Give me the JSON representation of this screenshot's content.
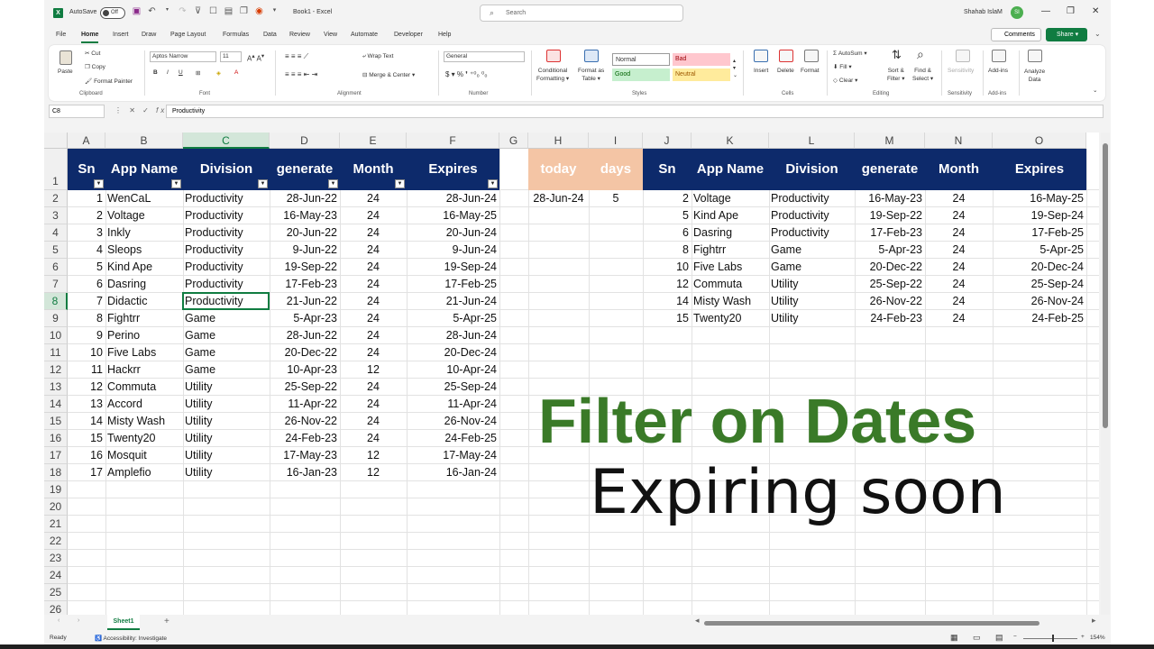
{
  "titlebar": {
    "autosave_label": "AutoSave",
    "autosave_state": "Off",
    "document_title": "Book1 - Excel",
    "search_placeholder": "Search",
    "user_name": "Shahab IslaM",
    "user_initials": "SI",
    "comments_label": "Comments",
    "share_label": "Share ▾"
  },
  "tabs": [
    "File",
    "Home",
    "Insert",
    "Draw",
    "Page Layout",
    "Formulas",
    "Data",
    "Review",
    "View",
    "Automate",
    "Developer",
    "Help"
  ],
  "ribbon": {
    "paste": "Paste",
    "cut": "Cut",
    "copy": "Copy",
    "format_painter": "Format Painter",
    "font_name": "Aptos Narrow",
    "font_size": "11",
    "wrap_text": "Wrap Text",
    "merge_center": "Merge & Center",
    "number_format": "General",
    "conditional_formatting_1": "Conditional",
    "conditional_formatting_2": "Formatting ▾",
    "format_as_table_1": "Format as",
    "format_as_table_2": "Table ▾",
    "styles": [
      "Normal",
      "Bad",
      "Good",
      "Neutral"
    ],
    "insert": "Insert",
    "delete": "Delete",
    "format": "Format",
    "autosum": "AutoSum",
    "fill": "Fill",
    "clear": "Clear",
    "sort_filter_1": "Sort &",
    "sort_filter_2": "Filter ▾",
    "find_select_1": "Find &",
    "find_select_2": "Select ▾",
    "sensitivity": "Sensitivity",
    "add_ins": "Add-ins",
    "analyze_data_1": "Analyze",
    "analyze_data_2": "Data",
    "groups": [
      "Clipboard",
      "Font",
      "Alignment",
      "Number",
      "Styles",
      "Cells",
      "Editing",
      "Sensitivity",
      "Add-ins"
    ]
  },
  "formula_bar": {
    "name_box": "C8",
    "content": "Productivity"
  },
  "columns": [
    "A",
    "B",
    "C",
    "D",
    "E",
    "F",
    "G",
    "H",
    "I",
    "J",
    "K",
    "L",
    "M",
    "N",
    "O"
  ],
  "rows": [
    "1",
    "2",
    "3",
    "4",
    "5",
    "6",
    "7",
    "8",
    "9",
    "10",
    "11",
    "12",
    "13",
    "14",
    "15",
    "16",
    "17",
    "18",
    "19",
    "20",
    "21",
    "22",
    "23",
    "24",
    "25",
    "26"
  ],
  "table_left": {
    "headers": [
      "Sn",
      "App Name",
      "Division",
      "generate",
      "Month",
      "Expires"
    ],
    "rows": [
      [
        "1",
        "WenCaL",
        "Productivity",
        "28-Jun-22",
        "24",
        "28-Jun-24"
      ],
      [
        "2",
        "Voltage",
        "Productivity",
        "16-May-23",
        "24",
        "16-May-25"
      ],
      [
        "3",
        "Inkly",
        "Productivity",
        "20-Jun-22",
        "24",
        "20-Jun-24"
      ],
      [
        "4",
        "Sleops",
        "Productivity",
        "9-Jun-22",
        "24",
        "9-Jun-24"
      ],
      [
        "5",
        "Kind Ape",
        "Productivity",
        "19-Sep-22",
        "24",
        "19-Sep-24"
      ],
      [
        "6",
        "Dasring",
        "Productivity",
        "17-Feb-23",
        "24",
        "17-Feb-25"
      ],
      [
        "7",
        "Didactic",
        "Productivity",
        "21-Jun-22",
        "24",
        "21-Jun-24"
      ],
      [
        "8",
        "Fightrr",
        "Game",
        "5-Apr-23",
        "24",
        "5-Apr-25"
      ],
      [
        "9",
        "Perino",
        "Game",
        "28-Jun-22",
        "24",
        "28-Jun-24"
      ],
      [
        "10",
        "Five Labs",
        "Game",
        "20-Dec-22",
        "24",
        "20-Dec-24"
      ],
      [
        "11",
        "Hackrr",
        "Game",
        "10-Apr-23",
        "12",
        "10-Apr-24"
      ],
      [
        "12",
        "Commuta",
        "Utility",
        "25-Sep-22",
        "24",
        "25-Sep-24"
      ],
      [
        "13",
        "Accord",
        "Utility",
        "11-Apr-22",
        "24",
        "11-Apr-24"
      ],
      [
        "14",
        "Misty Wash",
        "Utility",
        "26-Nov-22",
        "24",
        "26-Nov-24"
      ],
      [
        "15",
        "Twenty20",
        "Utility",
        "24-Feb-23",
        "24",
        "24-Feb-25"
      ],
      [
        "16",
        "Mosquit",
        "Utility",
        "17-May-23",
        "12",
        "17-May-24"
      ],
      [
        "17",
        "Amplefio",
        "Utility",
        "16-Jan-23",
        "12",
        "16-Jan-24"
      ]
    ]
  },
  "criteria": {
    "headers": [
      "today",
      "days"
    ],
    "values": [
      "28-Jun-24",
      "5"
    ]
  },
  "table_right": {
    "headers": [
      "Sn",
      "App Name",
      "Division",
      "generate",
      "Month",
      "Expires"
    ],
    "rows": [
      [
        "2",
        "Voltage",
        "Productivity",
        "16-May-23",
        "24",
        "16-May-25"
      ],
      [
        "5",
        "Kind Ape",
        "Productivity",
        "19-Sep-22",
        "24",
        "19-Sep-24"
      ],
      [
        "6",
        "Dasring",
        "Productivity",
        "17-Feb-23",
        "24",
        "17-Feb-25"
      ],
      [
        "8",
        "Fightrr",
        "Game",
        "5-Apr-23",
        "24",
        "5-Apr-25"
      ],
      [
        "10",
        "Five Labs",
        "Game",
        "20-Dec-22",
        "24",
        "20-Dec-24"
      ],
      [
        "12",
        "Commuta",
        "Utility",
        "25-Sep-22",
        "24",
        "25-Sep-24"
      ],
      [
        "14",
        "Misty Wash",
        "Utility",
        "26-Nov-22",
        "24",
        "26-Nov-24"
      ],
      [
        "15",
        "Twenty20",
        "Utility",
        "24-Feb-23",
        "24",
        "24-Feb-25"
      ]
    ]
  },
  "overlay": {
    "title": "Filter on Dates",
    "subtitle": "Expiring soon"
  },
  "selection": {
    "active_column": "C",
    "active_row": "8"
  },
  "sheet_tabs": [
    "Sheet1"
  ],
  "status": {
    "mode": "Ready",
    "accessibility": "Accessibility: Investigate",
    "zoom": "154%"
  },
  "colors": {
    "header_fill": "#0d2a6b",
    "criteria_fill": "#f4c5a5",
    "title_green": "#3a7a28",
    "excel_green": "#107c41"
  }
}
